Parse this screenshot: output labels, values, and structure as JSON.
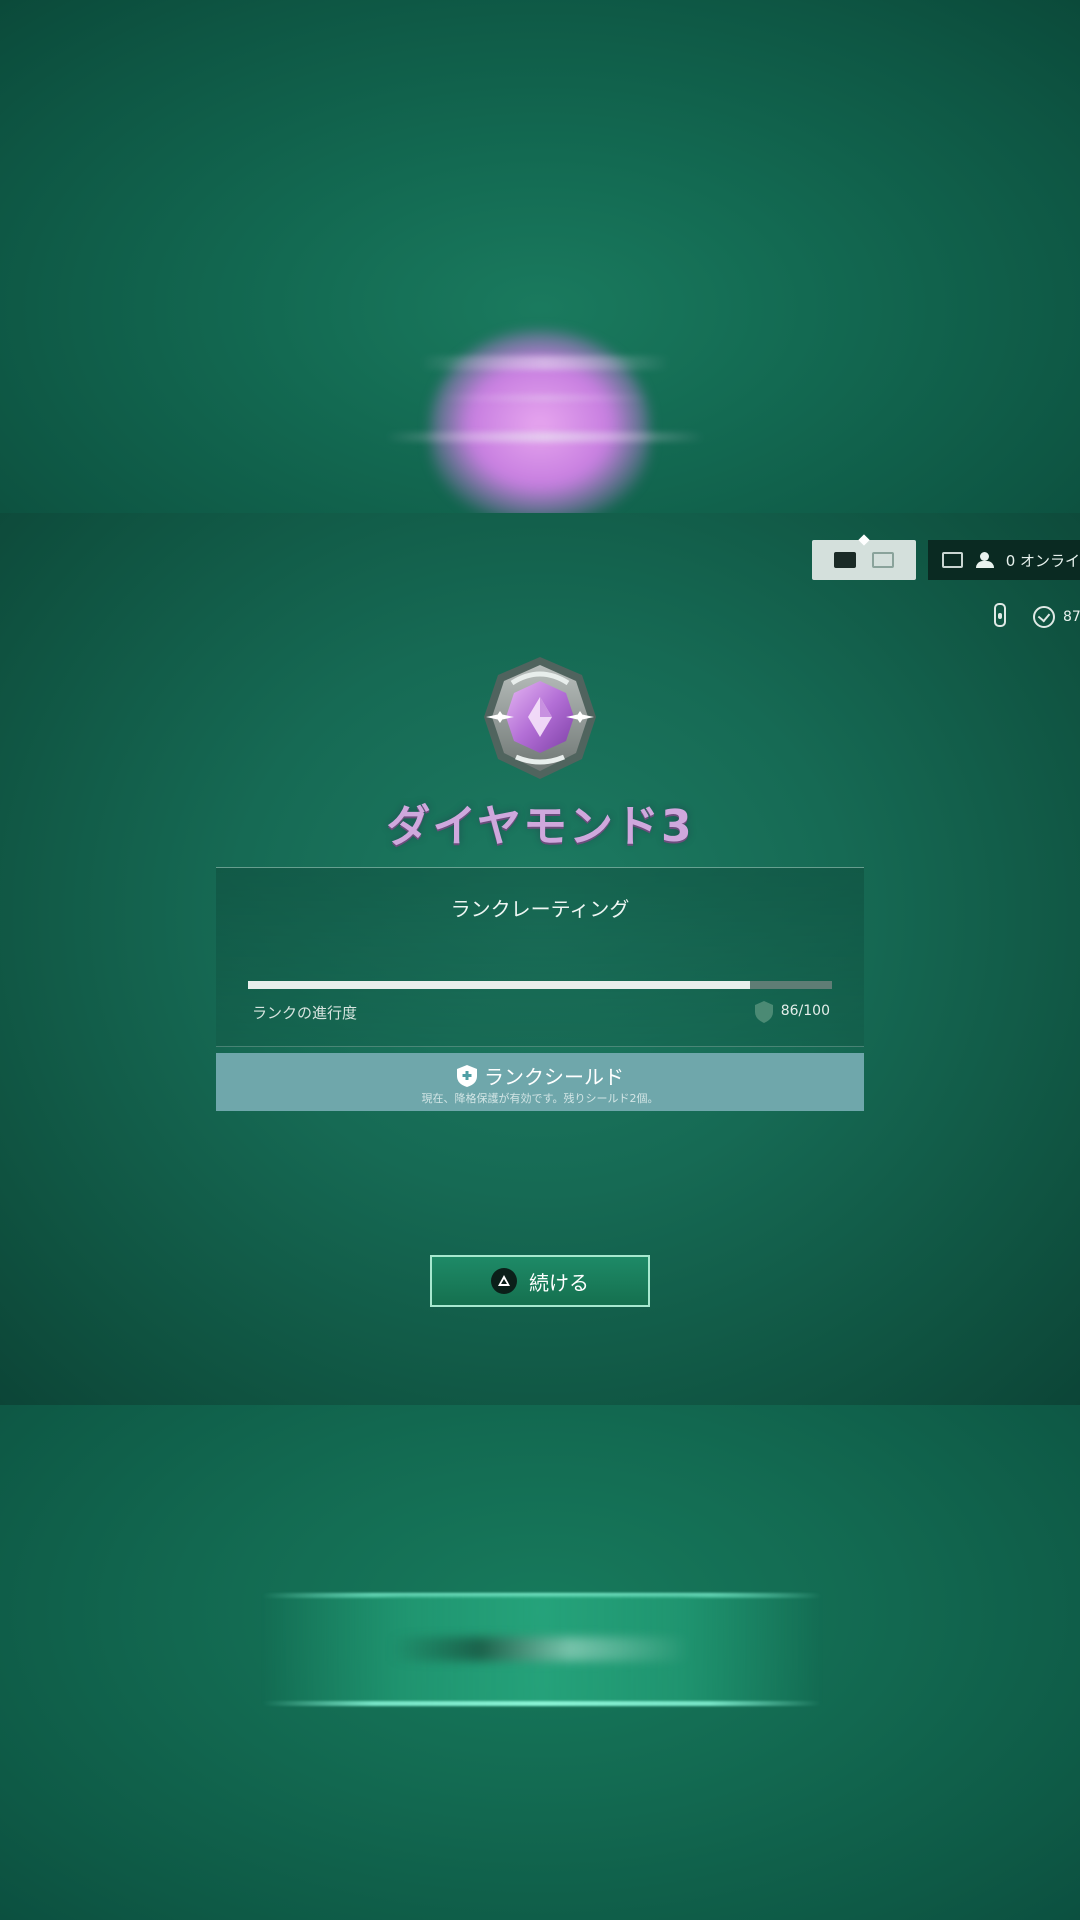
{
  "header": {
    "online_label": "0 オンライ",
    "level_value": "87"
  },
  "rank": {
    "title": "ダイヤモンド3",
    "emblem_color": "#b36fd6"
  },
  "rating": {
    "title": "ランクレーティング",
    "progress_label": "ランクの進行度",
    "progress_text": "86/100",
    "progress_fraction": 0.86
  },
  "shield": {
    "title": "ランクシールド",
    "subtitle": "現在、降格保護が有効です。残りシールド2個。"
  },
  "continue": {
    "label": "続ける"
  },
  "colors": {
    "background": "#166a54",
    "shield_bar": "#6fa7ab",
    "button_border": "#a7e8cf",
    "rank_text": "#cfa8dd"
  }
}
